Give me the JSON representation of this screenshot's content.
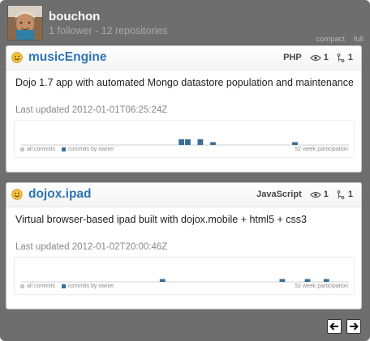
{
  "user": {
    "username": "bouchon",
    "stats": "1 follower - 12 repositories"
  },
  "view_toggle": {
    "compact_label": "compact",
    "full_label": "full"
  },
  "repos": [
    {
      "name": "musicEngine",
      "language": "PHP",
      "watchers": "1",
      "forks": "1",
      "description": "Dojo 1.7 app with automated Mongo datastore population and maintenance",
      "last_updated": "Last updated 2012-01-01T06:25:24Z",
      "graph": {
        "legend_all": "all commits",
        "legend_owner": "commits by owner",
        "participation_label": "52 week participation",
        "weeks_with_commits": [
          {
            "week": 25,
            "all": 1,
            "owner": 1
          },
          {
            "week": 26,
            "all": 1,
            "owner": 1
          },
          {
            "week": 28,
            "all": 1,
            "owner": 1
          },
          {
            "week": 30,
            "all": 0.5,
            "owner": 0.5
          },
          {
            "week": 43,
            "all": 0.5,
            "owner": 0.5
          }
        ]
      }
    },
    {
      "name": "dojox.ipad",
      "language": "JavaScript",
      "watchers": "1",
      "forks": "1",
      "description": "Virtual browser-based ipad built with dojox.mobile + html5 + css3",
      "last_updated": "Last updated 2012-01-02T20:00:46Z",
      "graph": {
        "legend_all": "all commits",
        "legend_owner": "commits by owner",
        "participation_label": "52 week participation",
        "weeks_with_commits": [
          {
            "week": 22,
            "all": 0.5,
            "owner": 0.5
          },
          {
            "week": 41,
            "all": 0.5,
            "owner": 0.5
          },
          {
            "week": 45,
            "all": 0.5,
            "owner": 0.5
          },
          {
            "week": 48,
            "all": 0.5,
            "owner": 0.5
          }
        ]
      }
    }
  ],
  "pagination": {
    "prev_icon": "arrow-left-icon",
    "next_icon": "arrow-right-icon"
  },
  "colors": {
    "repo_link": "#2e75b5",
    "owner_commits": "#3b6e96",
    "all_commits": "#c8c8c8",
    "widget_bg": "#6e6e6e"
  }
}
